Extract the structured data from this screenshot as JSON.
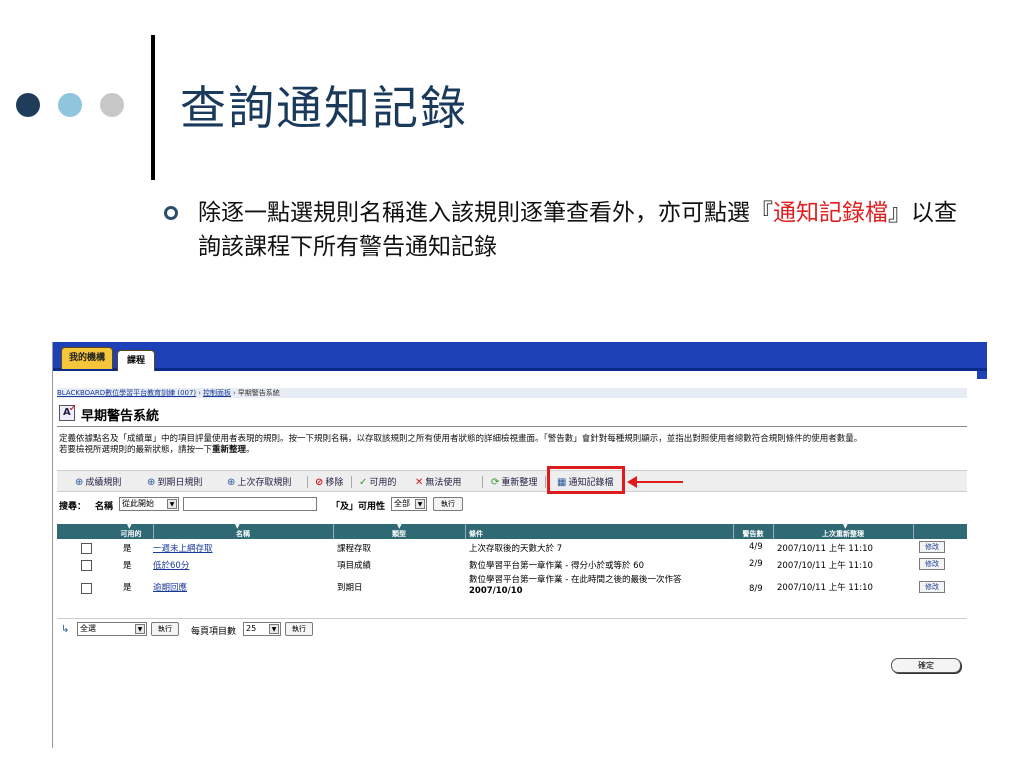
{
  "slide": {
    "title": "查詢通知記錄",
    "bullet_before": "除逐一點選規則名稱進入該規則逐筆查看外，亦可點選『",
    "bullet_highlight": "通知記錄檔",
    "bullet_after": "』以查詢該課程下所有警告通知記錄",
    "colors": {
      "title": "#1a3a5c",
      "highlight": "#e02020",
      "annotation": "#e01b1b"
    }
  },
  "app": {
    "tabs": [
      {
        "label": "我的機構"
      },
      {
        "label": "課程"
      }
    ],
    "breadcrumb": {
      "items": [
        "BLACKBOARD數位學習平台教育訓練 (007)",
        "控制面板"
      ],
      "current": "早期警告系統"
    },
    "page_title": "早期警告系統",
    "description_line1": "定義依據點名及「成績單」中的項目評量使用者表現的規則。按一下規則名稱，以存取該規則之所有使用者狀態的詳細檢視畫面。「警告數」會針對每種規則顯示，並指出對照使用者總數符合規則條件的使用者數量。",
    "description_line2_prefix": "若要檢視所選規則的最新狀態，請按一下",
    "description_line2_bold": "重新整理",
    "description_line2_suffix": "。",
    "toolbar": {
      "grade_rule": "成績規則",
      "due_date_rule": "到期日規則",
      "last_access_rule": "上次存取規則",
      "remove": "移除",
      "available": "可用的",
      "unavailable": "無法使用",
      "refresh": "重新整理",
      "notification_log": "通知記錄檔"
    },
    "search": {
      "label": "搜尋：",
      "field_label": "名稱",
      "mode_value": "從此開始",
      "keyword_value": "",
      "and_label": "「及」可用性",
      "availability_value": "全部",
      "go_button": "執行"
    },
    "table": {
      "headers": {
        "available": "可用的",
        "name": "名稱",
        "type": "類型",
        "criteria": "條件",
        "warnings": "警告數",
        "last_refresh": "上次重新整理"
      },
      "rows": [
        {
          "available": "是",
          "name": "一週未上網存取",
          "type": "課程存取",
          "criteria": "上次存取後的天數大於 7",
          "criteria_bold": "",
          "warnings": "4/9",
          "last_refresh": "2007/10/11 上午 11:10",
          "edit": "修改"
        },
        {
          "available": "是",
          "name": "低於60分",
          "type": "項目成績",
          "criteria": "數位學習平台第一章作業 - 得分小於或等於 60",
          "criteria_bold": "",
          "warnings": "2/9",
          "last_refresh": "2007/10/11 上午 11:10",
          "edit": "修改"
        },
        {
          "available": "是",
          "name": "逾期回應",
          "type": "到期日",
          "criteria": "數位學習平台第一章作業 - 在此時間之後的最後一次作答",
          "criteria_bold": "2007/10/10",
          "warnings": "8/9",
          "last_refresh": "2007/10/11 上午 11:10",
          "edit": "修改"
        }
      ]
    },
    "footer": {
      "select_value": "全選",
      "go_button": "執行",
      "items_per_page_label": "每頁項目數",
      "items_per_page_value": "25",
      "go_button_2": "執行"
    },
    "ok_button": "確定"
  }
}
